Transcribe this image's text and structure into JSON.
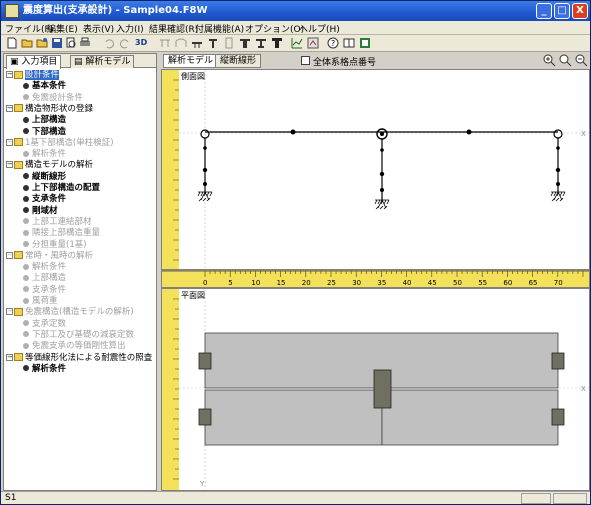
{
  "window": {
    "title": "震度算出(支承設計) - Sample04.F8W",
    "minimize": "_",
    "maximize": "□",
    "close": "X"
  },
  "menu": [
    "ファイル(F)",
    "編集(E)",
    "表示(V)",
    "入力(I)",
    "結果確認(R)",
    "付属機能(A)",
    "オプション(O)",
    "ヘルプ(H)"
  ],
  "toolbar": {
    "label_3d": "3D"
  },
  "left_tabs": [
    "入力項目",
    "解析モデル"
  ],
  "tree": [
    {
      "label": "設計条件",
      "level": 0,
      "kind": "folder",
      "state": "selected"
    },
    {
      "label": "基本条件",
      "level": 1,
      "kind": "item",
      "state": "bold"
    },
    {
      "label": "免震設計条件",
      "level": 1,
      "kind": "item",
      "state": "dim"
    },
    {
      "label": "構造物形状の登録",
      "level": 0,
      "kind": "folder",
      "state": "normal"
    },
    {
      "label": "上部構造",
      "level": 1,
      "kind": "item",
      "state": "bold"
    },
    {
      "label": "下部構造",
      "level": 1,
      "kind": "item",
      "state": "bold"
    },
    {
      "label": "1基下部構造(単柱検証)",
      "level": 0,
      "kind": "folder",
      "state": "dim"
    },
    {
      "label": "解析条件",
      "level": 1,
      "kind": "item",
      "state": "dim"
    },
    {
      "label": "構造モデルの解析",
      "level": 0,
      "kind": "folder",
      "state": "normal"
    },
    {
      "label": "縦断線形",
      "level": 1,
      "kind": "item",
      "state": "bold"
    },
    {
      "label": "上下部構造の配置",
      "level": 1,
      "kind": "item",
      "state": "bold"
    },
    {
      "label": "支承条件",
      "level": 1,
      "kind": "item",
      "state": "bold"
    },
    {
      "label": "剛域材",
      "level": 1,
      "kind": "item",
      "state": "bold"
    },
    {
      "label": "上部工連結部材",
      "level": 1,
      "kind": "item",
      "state": "dim"
    },
    {
      "label": "隣接上部構造重量",
      "level": 1,
      "kind": "item",
      "state": "dim"
    },
    {
      "label": "分担重量(1基)",
      "level": 1,
      "kind": "item",
      "state": "dim"
    },
    {
      "label": "常時・風時の解析",
      "level": 0,
      "kind": "folder",
      "state": "dim"
    },
    {
      "label": "解析条件",
      "level": 1,
      "kind": "item",
      "state": "dim"
    },
    {
      "label": "上部構造",
      "level": 1,
      "kind": "item",
      "state": "dim"
    },
    {
      "label": "支承条件",
      "level": 1,
      "kind": "item",
      "state": "dim"
    },
    {
      "label": "風荷重",
      "level": 1,
      "kind": "item",
      "state": "dim"
    },
    {
      "label": "免震構造(構造モデルの解析)",
      "level": 0,
      "kind": "folder",
      "state": "dim"
    },
    {
      "label": "支承定数",
      "level": 1,
      "kind": "item",
      "state": "dim"
    },
    {
      "label": "下部工及び基礎の減衰定数",
      "level": 1,
      "kind": "item",
      "state": "dim"
    },
    {
      "label": "免震支承の等価剛性算出",
      "level": 1,
      "kind": "item",
      "state": "dim"
    },
    {
      "label": "等価線形化法による耐震性の照査",
      "level": 0,
      "kind": "folder",
      "state": "normal"
    },
    {
      "label": "解析条件",
      "level": 1,
      "kind": "item",
      "state": "bold"
    }
  ],
  "right_tabs": [
    "解析モデル",
    "縦断線形"
  ],
  "checkbox_label": "全体系格点番号",
  "side_view": {
    "label": "側面図",
    "axis_x": "X",
    "axis_z": "Z"
  },
  "plan_view": {
    "label": "平面図",
    "axis_x": "X",
    "axis_y": "Y"
  },
  "ruler_ticks": [
    "0",
    "5",
    "10",
    "15",
    "20",
    "25",
    "30",
    "35",
    "40",
    "45",
    "50",
    "55",
    "60",
    "65",
    "70"
  ],
  "status": {
    "text": "S1"
  },
  "colors": {
    "title_bar": "#1f58d0",
    "ruler": "#f4e15a",
    "deck": "#c0c0c0",
    "pier_cap": "#707060",
    "selection": "#316ac5"
  }
}
